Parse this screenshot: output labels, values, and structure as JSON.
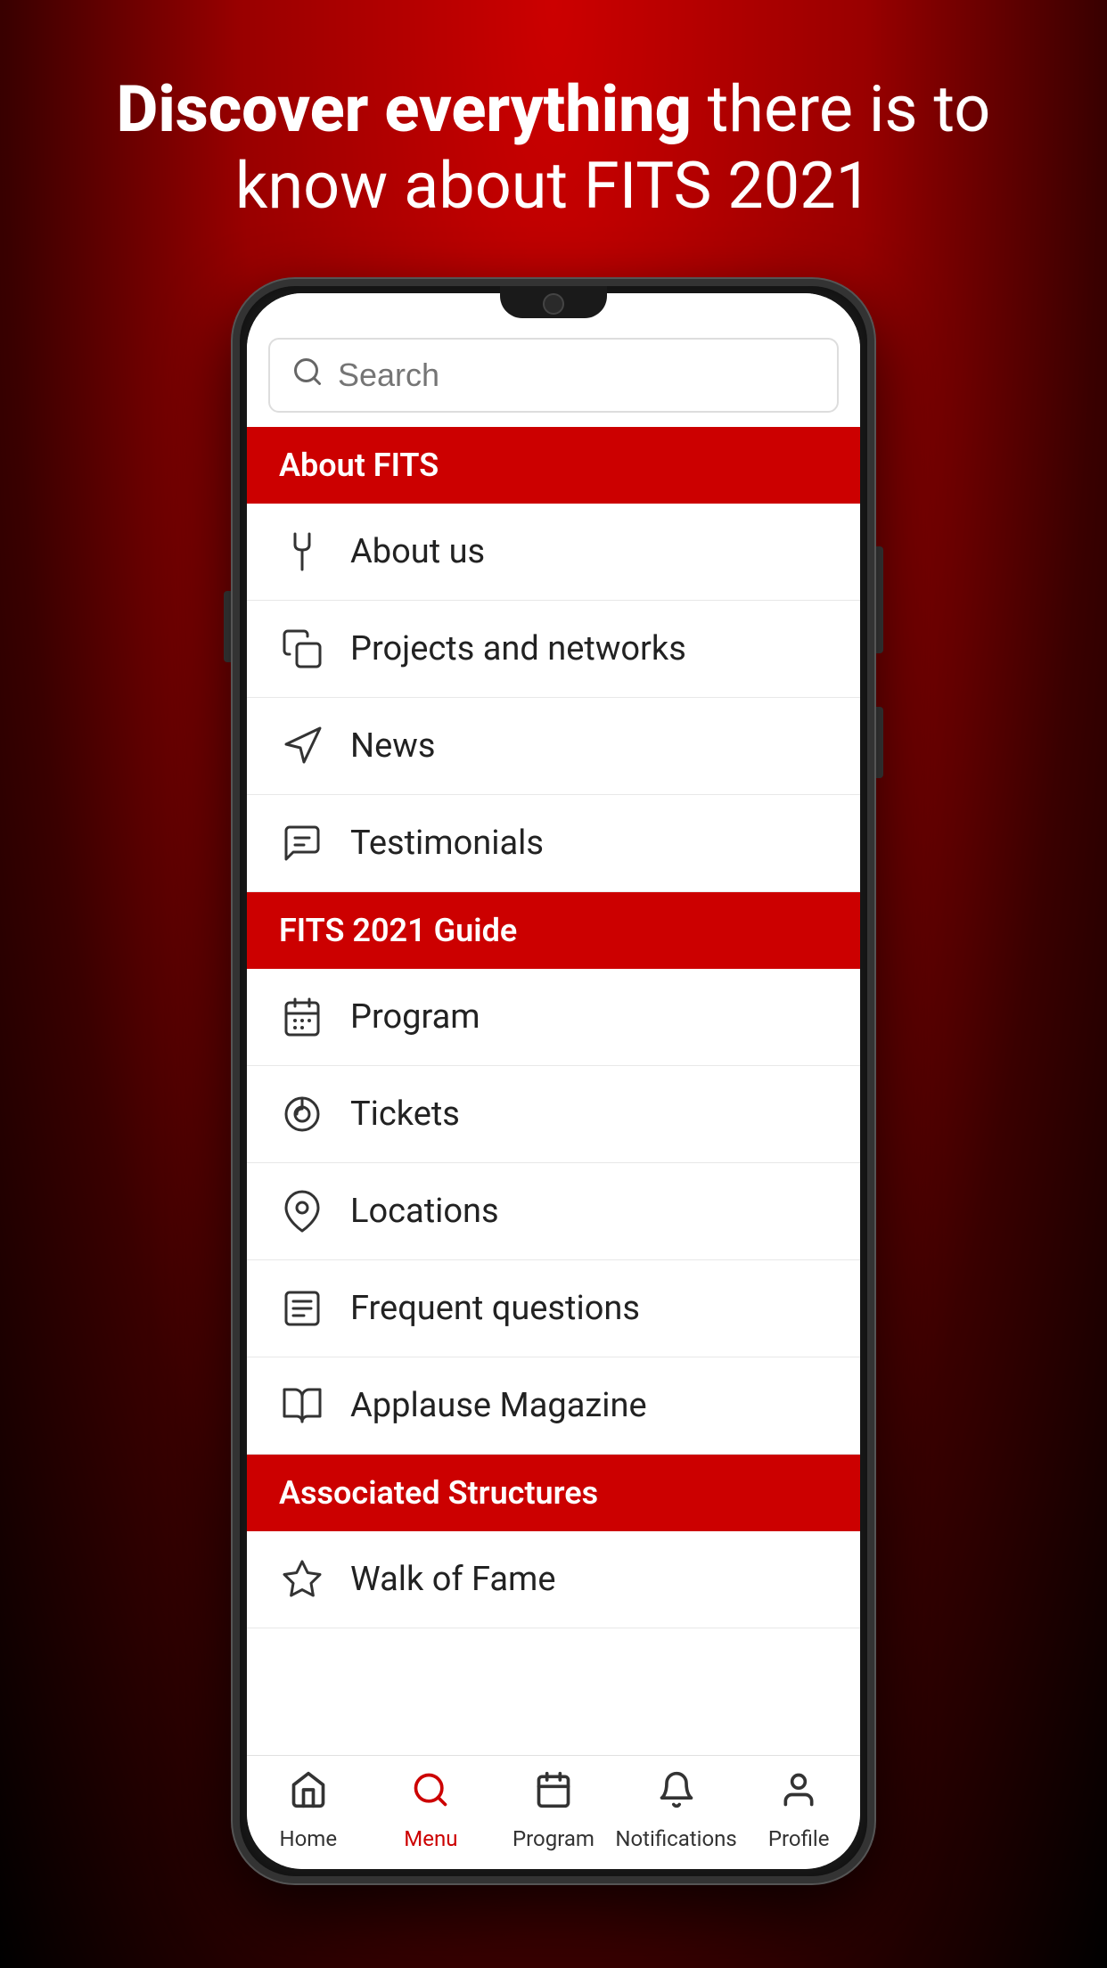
{
  "hero": {
    "title_bold": "Discover everything",
    "title_regular": " there is to know about FITS 2021"
  },
  "search": {
    "placeholder": "Search"
  },
  "sections": [
    {
      "id": "about-fits",
      "label": "About FITS",
      "items": [
        {
          "id": "about-us",
          "label": "About us",
          "icon": "fork-icon"
        },
        {
          "id": "projects-networks",
          "label": "Projects and networks",
          "icon": "copy-icon"
        },
        {
          "id": "news",
          "label": "News",
          "icon": "navigation-icon"
        },
        {
          "id": "testimonials",
          "label": "Testimonials",
          "icon": "message-icon"
        }
      ]
    },
    {
      "id": "fits-guide",
      "label": "FITS 2021 Guide",
      "items": [
        {
          "id": "program",
          "label": "Program",
          "icon": "calendar-icon"
        },
        {
          "id": "tickets",
          "label": "Tickets",
          "icon": "ticket-icon"
        },
        {
          "id": "locations",
          "label": "Locations",
          "icon": "location-icon"
        },
        {
          "id": "frequent-questions",
          "label": "Frequent questions",
          "icon": "faq-icon"
        },
        {
          "id": "applause-magazine",
          "label": "Applause Magazine",
          "icon": "book-icon"
        }
      ]
    },
    {
      "id": "associated-structures",
      "label": "Associated Structures",
      "items": [
        {
          "id": "walk-of-fame",
          "label": "Walk of Fame",
          "icon": "star-icon"
        }
      ]
    }
  ],
  "bottom_nav": [
    {
      "id": "home",
      "label": "Home",
      "icon": "home-icon",
      "active": false
    },
    {
      "id": "menu",
      "label": "Menu",
      "icon": "menu-icon",
      "active": true
    },
    {
      "id": "program-nav",
      "label": "Program",
      "icon": "calendar-nav-icon",
      "active": false
    },
    {
      "id": "notifications",
      "label": "Notifications",
      "icon": "bell-icon",
      "active": false
    },
    {
      "id": "profile",
      "label": "Profile",
      "icon": "person-icon",
      "active": false
    }
  ]
}
